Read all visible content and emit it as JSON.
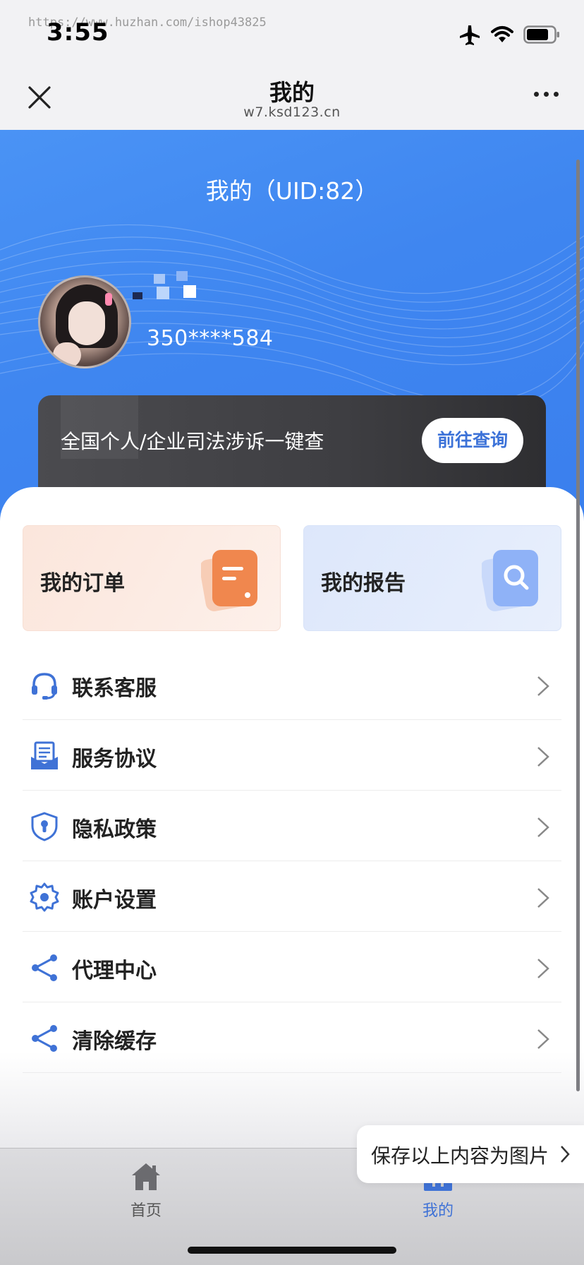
{
  "status": {
    "watermark": "https://www.huzhan.com/ishop43825",
    "time": "3:55"
  },
  "nav": {
    "title": "我的",
    "subtitle": "w7.ksd123.cn"
  },
  "profile": {
    "header": "我的（UID:82）",
    "phone": "350****584"
  },
  "banner": {
    "text": "全国个人/企业司法涉诉一键查",
    "button": "前往查询"
  },
  "tiles": {
    "orders": "我的订单",
    "reports": "我的报告"
  },
  "menu": [
    {
      "label": "联系客服",
      "icon": "headset-icon"
    },
    {
      "label": "服务协议",
      "icon": "document-icon"
    },
    {
      "label": "隐私政策",
      "icon": "shield-icon"
    },
    {
      "label": "账户设置",
      "icon": "gear-icon"
    },
    {
      "label": "代理中心",
      "icon": "share-icon"
    },
    {
      "label": "清除缓存",
      "icon": "share-icon"
    }
  ],
  "save_pill": "保存以上内容为图片",
  "tabs": {
    "home": "首页",
    "mine": "我的"
  },
  "colors": {
    "accent": "#3f72d6",
    "hero": "#4a93f5",
    "orders_tile": "#fbe6dc",
    "reports_tile": "#dde7fb"
  }
}
